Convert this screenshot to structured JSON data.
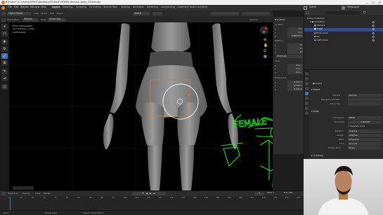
{
  "window": {
    "title": "Blender* [C:\\Users\\ROHIT\\Desktop\\FEMALE MODEL\\female_body_03.blend]"
  },
  "menu": [
    "File",
    "Edit",
    "Render",
    "Window",
    "Help"
  ],
  "workspace_tabs": [
    "Layout",
    "Modeling",
    "Sculpting",
    "UV Editing",
    "Texture Paint",
    "Shading",
    "Animation",
    "Rendering",
    "Compositing",
    "Geometry Nodes",
    "Scripting"
  ],
  "active_workspace": "Layout",
  "scene": {
    "name": "Scene",
    "view_layer": "ViewLayer"
  },
  "header": {
    "mode": "Object Mode",
    "view": "View",
    "select": "Select",
    "add": "Add",
    "object": "Object",
    "orientation": "Global",
    "orientation_label": "Orientation:",
    "orientation_value": "Default",
    "drag": "Drag:",
    "drag_value": "Select Box",
    "options": "Options"
  },
  "viewport_overlay": {
    "line1": "Front Orthographic",
    "line2": "(1) Collection | Cube",
    "line3": "Centimeters"
  },
  "annotation": {
    "text": "FEMALE"
  },
  "npanel": {
    "transform": "Transform",
    "location": "Location:",
    "loc": [
      {
        "axis": "X",
        "value": "0 m"
      },
      {
        "axis": "Y",
        "value": "0 m"
      },
      {
        "axis": "Z",
        "value": "0.98918 m"
      }
    ],
    "rotation": "Rotation:",
    "rot": [
      {
        "axis": "X",
        "value": "0°"
      },
      {
        "axis": "Y",
        "value": "0°"
      },
      {
        "axis": "Z",
        "value": "0°"
      }
    ],
    "mode": "XYZ Euler",
    "scale": "Scale:",
    "scl": [
      {
        "axis": "X",
        "value": "0.11..."
      },
      {
        "axis": "Y",
        "value": "0.11..."
      },
      {
        "axis": "Z",
        "value": "0.11..."
      }
    ],
    "dimensions": "Dimensions:",
    "dim": [
      {
        "axis": "X",
        "value": "0.222 m"
      },
      {
        "axis": "Y",
        "value": "0.222 m"
      },
      {
        "axis": "Z",
        "value": "0.222 m"
      }
    ],
    "tabs": [
      "Item",
      "Tool",
      "View"
    ]
  },
  "outliner": {
    "title": "Scene Collection",
    "items": [
      {
        "label": "Collection",
        "level": 0
      },
      {
        "label": "Camera",
        "level": 1
      },
      {
        "label": "Cube",
        "level": 1
      },
      {
        "label": "Body Lines",
        "level": 1
      },
      {
        "label": "GP",
        "level": 1
      },
      {
        "label": "Light Lines",
        "level": 1
      }
    ]
  },
  "properties": {
    "scene_label": "Scene",
    "scene_section": "Scene",
    "camera_label": "Camera",
    "camera_value": "Camera",
    "background_label": "Background Scene",
    "active_clip_label": "Active Clip",
    "units_section": "Units",
    "unit_system_label": "Unit System",
    "unit_system": "Metric",
    "unit_scale_label": "Unit Scale",
    "unit_scale": "1.000000",
    "separate_units": "Separate Units",
    "rotation_label": "Rotation",
    "rotation": "Degrees",
    "length_label": "Length",
    "length": "Adaptive",
    "mass_label": "Mass",
    "mass": "Kilograms",
    "time_label": "Time",
    "time": "Seconds",
    "temperature_label": "Temperature",
    "temperature": "Kelvin",
    "gravity": "Gravity"
  },
  "timeline": {
    "playback": "Playback",
    "keying": "Keying",
    "view": "View",
    "marker": "Marker",
    "current_frame": "1",
    "start_label": "Start",
    "start": "1",
    "end_label": "End",
    "end": "250",
    "ticks": [
      "0",
      "10",
      "20",
      "30",
      "40",
      "50",
      "60",
      "70",
      "80",
      "90",
      "100",
      "110",
      "120",
      "130",
      "140",
      "150",
      "160",
      "170",
      "180",
      "190",
      "200",
      "210",
      "220",
      "230",
      "240",
      "250"
    ]
  },
  "status": {
    "select": "Select",
    "rotate": "Rotate View",
    "menu": "Object Context Menu"
  },
  "colors": {
    "accent": "#4772b3",
    "annotation_green": "#22e022",
    "model": "#8a8a8a"
  }
}
